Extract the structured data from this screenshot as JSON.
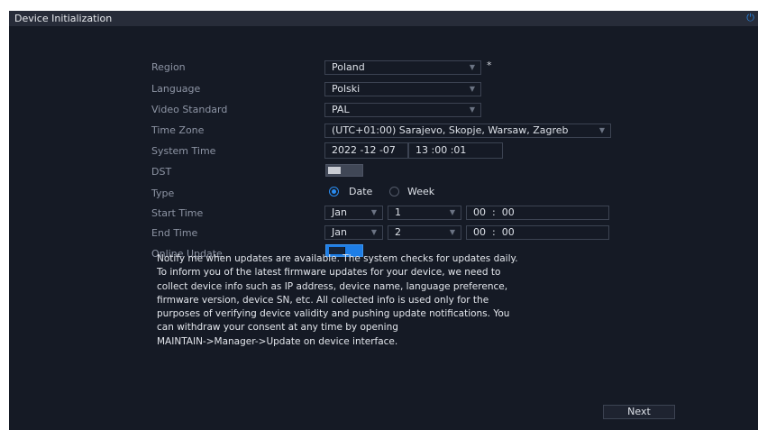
{
  "window": {
    "title": "Device Initialization",
    "power_icon": "power-icon"
  },
  "form": {
    "region": {
      "label": "Region",
      "value": "Poland",
      "required_mark": "*"
    },
    "language": {
      "label": "Language",
      "value": "Polski"
    },
    "video_standard": {
      "label": "Video Standard",
      "value": "PAL"
    },
    "time_zone": {
      "label": "Time Zone",
      "value": "(UTC+01:00) Sarajevo, Skopje, Warsaw, Zagreb"
    },
    "system_time": {
      "label": "System Time",
      "date": "2022 -12 -07",
      "time": "13 :00 :01"
    },
    "dst": {
      "label": "DST",
      "enabled": false
    },
    "type": {
      "label": "Type",
      "options": [
        "Date",
        "Week"
      ],
      "selected": "Date"
    },
    "start_time": {
      "label": "Start Time",
      "month": "Jan",
      "day": "1",
      "time": "00  :  00"
    },
    "end_time": {
      "label": "End Time",
      "month": "Jan",
      "day": "2",
      "time": "00  :  00"
    },
    "online_update": {
      "label": "Online Update",
      "enabled": true
    }
  },
  "notice": {
    "lines": [
      "Notify me when updates are available. The system checks for updates daily.",
      "To inform you of the latest firmware updates for your device, we need to",
      "collect device info such as IP address, device name, language preference,",
      "firmware version, device SN, etc. All collected info is used only for the",
      "purposes of verifying device validity and pushing update notifications. You",
      "can withdraw your consent at any time by opening",
      "MAINTAIN->Manager->Update on device interface."
    ]
  },
  "footer": {
    "next_label": "Next"
  },
  "colors": {
    "background": "#151a25",
    "titlebar": "#272c39",
    "accent": "#1e7ee6",
    "label": "#8d94a4",
    "text": "#dde1e8"
  }
}
